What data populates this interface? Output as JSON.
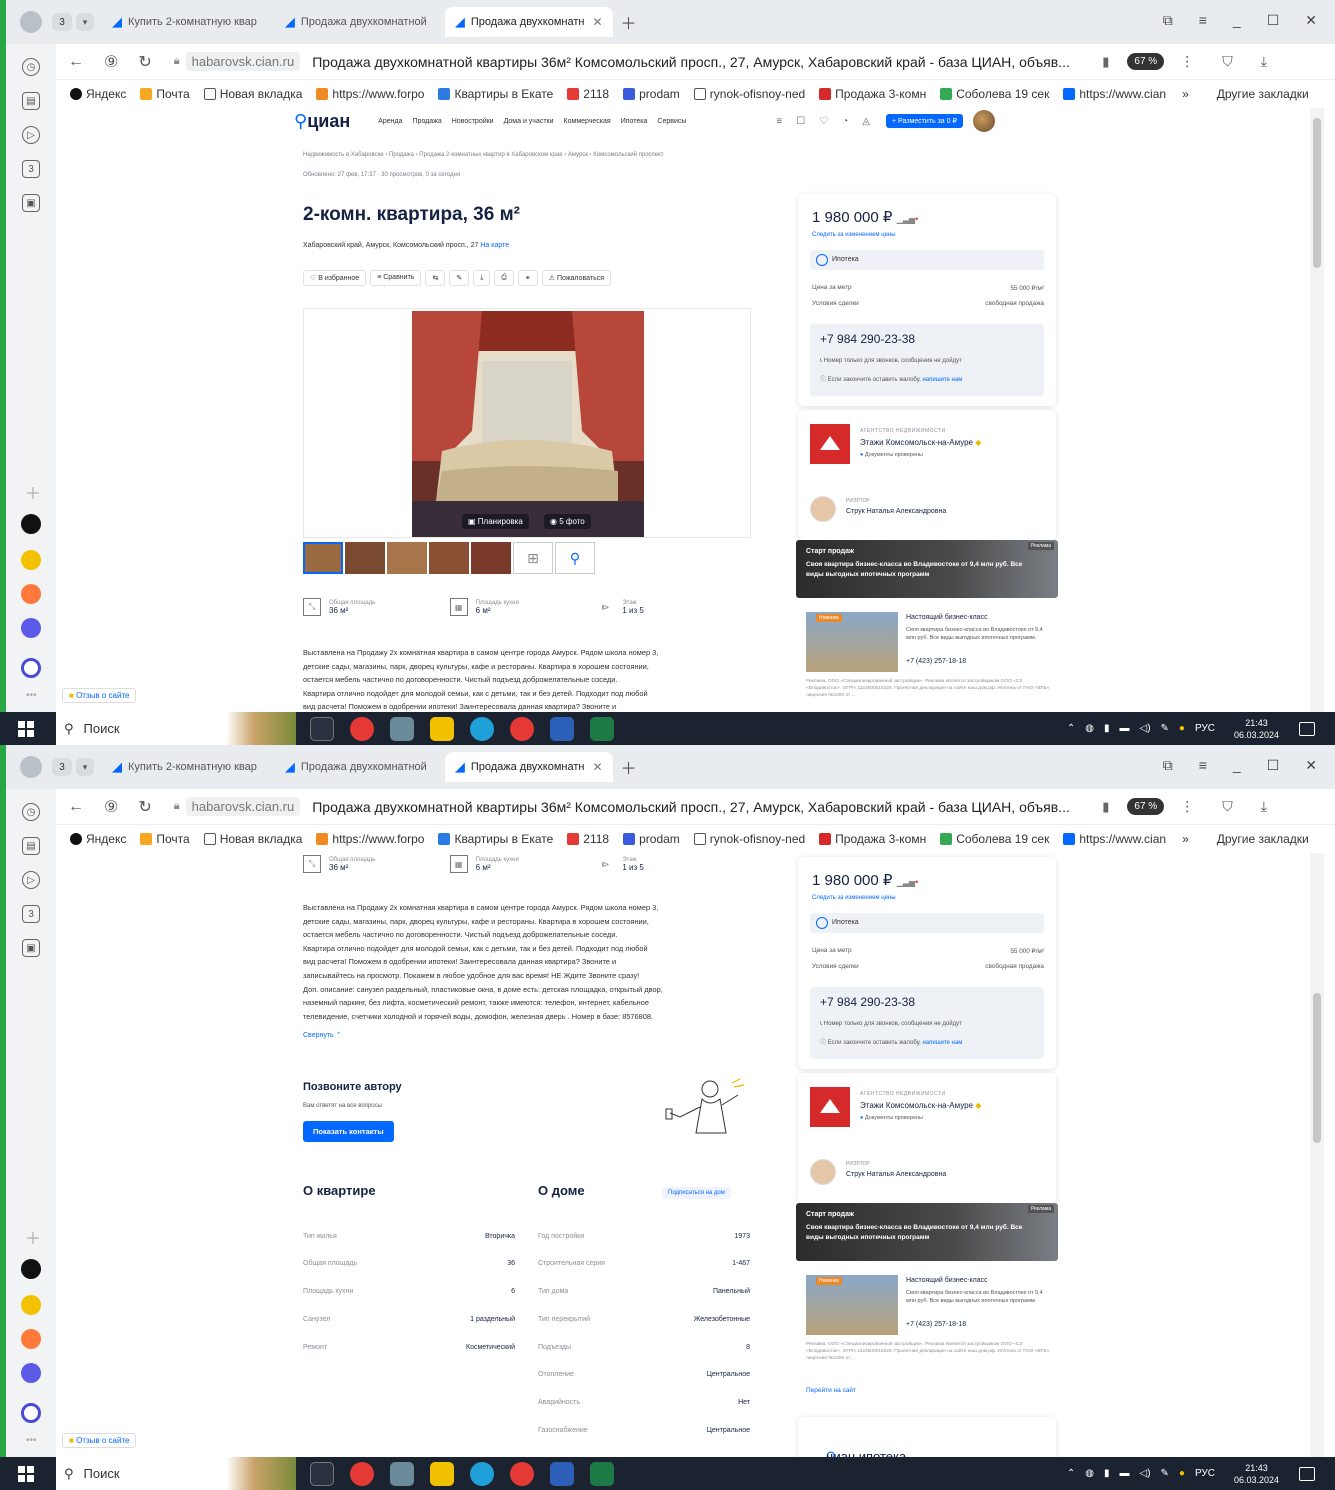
{
  "browser": {
    "tab_counter": "3",
    "tabs": [
      {
        "label": "Купить 2-комнатную квар"
      },
      {
        "label": "Продажа двухкомнатной"
      },
      {
        "label": "Продажа двухкомнатн"
      }
    ],
    "url_host": "habarovsk.cian.ru",
    "page_title": "Продажа двухкомнатной квартиры 36м² Комсомольский просп., 27, Амурск, Хабаровский край - база ЦИАН, объяв...",
    "zoom": "67 %",
    "bookmarks": [
      {
        "label": "Яндекс",
        "color": "#111111"
      },
      {
        "label": "Почта",
        "color": "#f5a623"
      },
      {
        "label": "Новая вкладка",
        "color": "#ffffff"
      },
      {
        "label": "https://www.forpo",
        "color": "#f08a24"
      },
      {
        "label": "Квартиры в Екате",
        "color": "#2c7be5"
      },
      {
        "label": "2118",
        "color": "#e53935"
      },
      {
        "label": "prodam",
        "color": "#3b5bdb"
      },
      {
        "label": "rynok-ofisnoy-ned",
        "color": "#ffffff"
      },
      {
        "label": "Продажа 3-комн",
        "color": "#d62a2a"
      },
      {
        "label": "Соболева 19 сек",
        "color": "#34a853"
      },
      {
        "label": "https://www.cian",
        "color": "#0468ff"
      }
    ],
    "bookmarks_more": "»",
    "other_bookmarks": "Другие закладки"
  },
  "cian": {
    "logo": "циан",
    "menu": [
      "Аренда",
      "Продажа",
      "Новостройки",
      "Дома и участки",
      "Коммерческая",
      "Ипотека",
      "Сервисы"
    ],
    "place_button": "+ Разместить за 0 ₽",
    "breadcrumbs": "Недвижимость в Хабаровске  ›  Продажа  ›  Продажа 2-комнатных квартир в Хабаровском крае  ›  Амурск  ›  Комсомольский проспект",
    "updated": "Обновлено: 27 фев, 17:37   ·   30 просмотров, 0 за сегодня",
    "title": "2-комн. квартира, 36 м²",
    "address": "Хабаровский край, Амурск, Комсомольский просп., 27",
    "map_link": "На карте",
    "actions": [
      "В избранное",
      "Сравнить",
      "⇆",
      "✎",
      "⤓",
      "⎙",
      "⚭",
      "Пожаловаться"
    ],
    "photo_plan": "Планировка",
    "photo_count": "5 фото",
    "specs": [
      {
        "icon": "area-icon",
        "label": "Общая площадь",
        "value": "36 м²"
      },
      {
        "icon": "kitchen-icon",
        "label": "Площадь кухни",
        "value": "6 м²"
      },
      {
        "icon": "stairs-icon",
        "label": "Этаж",
        "value": "1 из 5"
      }
    ],
    "description": [
      "Выставлена на Продажу 2х комнатная квартира в самом центре города Амурск. Рядом школа номер 3,",
      "детские сады, магазины, парк, дворец культуры, кафе и рестораны. Квартира в хорошем состоянии,",
      "остается мебель частично по договоренности. Чистый подъезд доброжелательные соседи.",
      "Квартира отлично подойдет для молодой семьи, как с детьми, так и без детей. Подходит под любой",
      "вид расчета! Поможем в одобрении ипотеки! Заинтересовала данная квартира? Звоните и",
      "записывайтесь на просмотр. Покажем в любое удобное для вас время! НЕ Ждите Звоните сразу!",
      "Доп. описание: санузел раздельный, пластиковые окна, в доме есть: детская площадка, открытый двор,",
      "наземный паркинг, без лифта, косметический ремонт, также имеются: телефон, интернет, кабельное",
      "телевидение, счетчики холодной и горячей воды, домофон, железная дверь . Номер в базе: 8576808."
    ],
    "collapse": "Свернуть ⌃",
    "call_title": "Позвоните автору",
    "call_sub": "Вам ответят на все вопросы",
    "call_button": "Показать контакты",
    "about_flat_title": "О квартире",
    "about_flat": [
      {
        "k": "Тип жилья",
        "v": "Вторичка"
      },
      {
        "k": "Общая площадь",
        "v": "36"
      },
      {
        "k": "Площадь кухни",
        "v": "6"
      },
      {
        "k": "Санузел",
        "v": "1 раздельный"
      },
      {
        "k": "Ремонт",
        "v": "Косметический"
      }
    ],
    "about_house_title": "О доме",
    "subscribe": "Подписаться на дом",
    "about_house": [
      {
        "k": "Год постройки",
        "v": "1973"
      },
      {
        "k": "Строительная серия",
        "v": "1-467"
      },
      {
        "k": "Тип дома",
        "v": "Панельный"
      },
      {
        "k": "Тип перекрытий",
        "v": "Железобетонные"
      },
      {
        "k": "Подъезды",
        "v": "8"
      },
      {
        "k": "Отопление",
        "v": "Центральное"
      },
      {
        "k": "Аварийность",
        "v": "Нет"
      },
      {
        "k": "Газоснабжение",
        "v": "Центральное"
      }
    ]
  },
  "sidebar_card": {
    "price": "1 980 000 ₽",
    "watch_price": "Следить за изменением цены",
    "mortgage": "Ипотека",
    "price_per_meter_label": "Цена за метр",
    "price_per_meter": "55 000 ₽/м²",
    "deal_label": "Условия сделки",
    "deal": "свободная продажа",
    "phone": "+7 984 290-23-38",
    "phone_note_1": "Номер только для звонков, сообщения не дойдут",
    "phone_note_2": "Если закончите оставить жалобу,",
    "phone_note_link": "напишите нам",
    "agency_type": "АГЕНТСТВО НЕДВИЖИМОСТИ",
    "agency_name": "Этажи Комсомольск-на-Амуре",
    "agency_docs": "Документы проверены",
    "realtor_type": "РИЭЛТОР",
    "realtor_name": "Струк Наталья Александровна",
    "ad_banner_1": "Старт продаж",
    "ad_banner_2": "Своя квартира бизнес-класса во Владивостоке от 9,4 млн руб. Все виды выгодных ипотечных программ",
    "ad_banner_tag": "Реклама",
    "ad_badge": "Новинка",
    "ad_title": "Настоящий бизнес-класс",
    "ad_text": "Своя квартира бизнес-класса во Владивостоке от 9,4 млн руб. Все виды выгодных ипотечных программ.",
    "ad_phone": "+7 (423) 257-18-18",
    "ad_legal": "Реклама. ООО «Специализированный застройщик». Реклама является застройщиком ООО «СЗ «Владивосток». ОГРН 1222500016326. Проектная декларация на сайте наш.дом.рф. Ипотека от ПАО «ВТБ», лицензия №1000 от ...",
    "ad_link": "Перейти на сайт",
    "cian_mortgage": "циан.ипотека"
  },
  "page_extra": {
    "feedback": "Отзыв о сайте"
  },
  "taskbar": {
    "search": "Поиск",
    "lang": "РУС",
    "time": "21:43",
    "date": "06.03.2024"
  }
}
